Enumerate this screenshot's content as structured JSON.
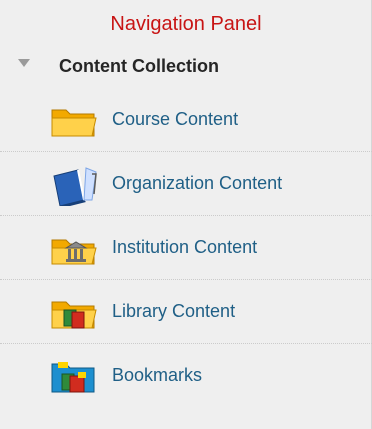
{
  "panel": {
    "title": "Navigation Panel"
  },
  "collection": {
    "label": "Content Collection",
    "expanded": true
  },
  "items": [
    {
      "label": "Course Content",
      "icon": "folder-icon"
    },
    {
      "label": "Organization Content",
      "icon": "book-icon"
    },
    {
      "label": "Institution Content",
      "icon": "institution-folder-icon"
    },
    {
      "label": "Library Content",
      "icon": "library-folder-icon"
    },
    {
      "label": "Bookmarks",
      "icon": "bookmarks-icon"
    }
  ],
  "colors": {
    "title": "#c81414",
    "link": "#1f5f86",
    "header": "#262626",
    "background": "#efefef"
  }
}
